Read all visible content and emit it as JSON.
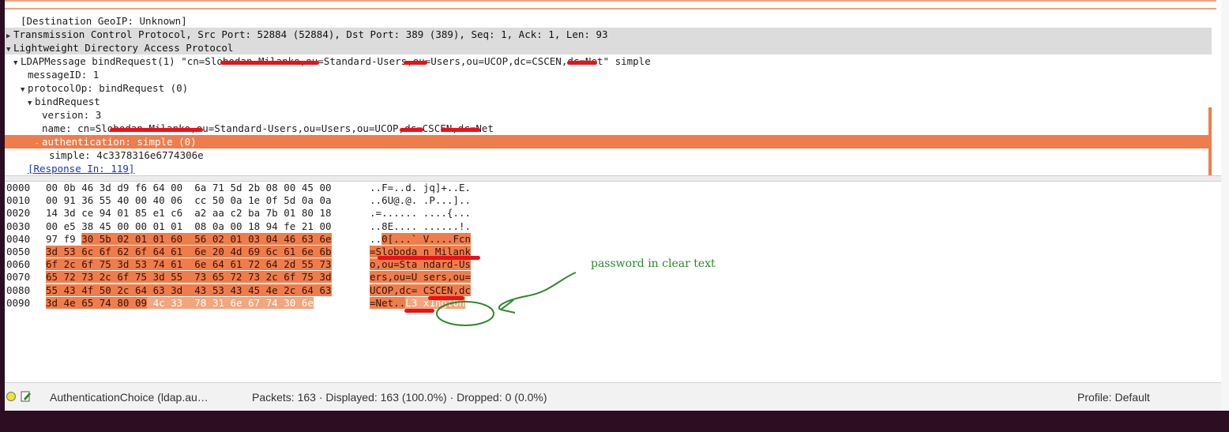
{
  "colors": {
    "selection": "#ef7d4c",
    "header_bg": "#dcdcdc",
    "link": "#1a35c8",
    "annotation": "#2a8a2a",
    "redaction": "#ef0f15"
  },
  "detail_tree": [
    {
      "indent": 1,
      "arrow": "",
      "text": "[Destination GeoIP: Unknown]",
      "kind": "normal"
    },
    {
      "indent": 0,
      "arrow": "▶",
      "text": "Transmission Control Protocol, Src Port: 52884 (52884), Dst Port: 389 (389), Seq: 1, Ack: 1, Len: 93",
      "kind": "header"
    },
    {
      "indent": 0,
      "arrow": "▼",
      "text": "Lightweight Directory Access Protocol",
      "kind": "header"
    },
    {
      "indent": 1,
      "arrow": "▼",
      "text": "LDAPMessage bindRequest(1) \"cn=Slobodan Milanko,ou=Standard-Users,ou=Users,ou=UCOP,dc=CSCEN,dc=Net\" simple",
      "kind": "normal"
    },
    {
      "indent": 2,
      "arrow": "",
      "text": "messageID: 1",
      "kind": "normal"
    },
    {
      "indent": 2,
      "arrow": "▼",
      "text": "protocolOp: bindRequest (0)",
      "kind": "normal"
    },
    {
      "indent": 3,
      "arrow": "▼",
      "text": "bindRequest",
      "kind": "normal"
    },
    {
      "indent": 4,
      "arrow": "",
      "text": "version: 3",
      "kind": "normal"
    },
    {
      "indent": 4,
      "arrow": "",
      "text": "name: cn=Slobodan Milanko,ou=Standard-Users,ou=Users,ou=UCOP,dc=CSCEN,dc=Net",
      "kind": "normal"
    },
    {
      "indent": 4,
      "arrow": "-",
      "text": "authentication: simple (0)",
      "kind": "selected"
    },
    {
      "indent": 5,
      "arrow": "",
      "text": "simple: 4c3378316e6774306e",
      "kind": "normal"
    },
    {
      "indent": 2,
      "arrow": "",
      "text": "[Response In: 119]",
      "kind": "link"
    }
  ],
  "hex_rows": [
    {
      "offset": "0000",
      "b1": "00 0b 46 3d d9 f6 64 00",
      "b2": "6a 71 5d 2b 08 00 45 00",
      "a1": "..F=..d.",
      "a2": "jq]+..E."
    },
    {
      "offset": "0010",
      "b1": "00 91 36 55 40 00 40 06",
      "b2": "cc 50 0a 1e 0f 5d 0a 0a",
      "a1": "..6U@.@.",
      "a2": ".P...]..",
      "_": ""
    },
    {
      "offset": "0020",
      "b1": "14 3d ce 94 01 85 e1 c6",
      "b2": "a2 aa c2 ba 7b 01 80 18",
      "a1": ".=......",
      "a2": "....{..."
    },
    {
      "offset": "0030",
      "b1": "00 e5 38 45 00 00 01 01",
      "b2": "08 0a 00 18 94 fe 21 00",
      "a1": "..8E....",
      "a2": "......!."
    },
    {
      "offset": "0040",
      "b1": "97 f9 30 5b 02 01 01 60",
      "b2": "56 02 01 03 04 46 63 6e",
      "a1": "..0[...`",
      "a2": "V....Fcn"
    },
    {
      "offset": "0050",
      "b1": "3d 53 6c 6f 62 6f 64 61",
      "b2": "6e 20 4d 69 6c 61 6e 6b",
      "a1": "=Slobodа",
      "a2": "n Milank"
    },
    {
      "offset": "0060",
      "b1": "6f 2c 6f 75 3d 53 74 61",
      "b2": "6e 64 61 72 64 2d 55 73",
      "a1": "o,ou=Sta",
      "a2": "ndard-Us"
    },
    {
      "offset": "0070",
      "b1": "65 72 73 2c 6f 75 3d 55",
      "b2": "73 65 72 73 2c 6f 75 3d",
      "a1": "ers,ou=U",
      "a2": "sers,ou="
    },
    {
      "offset": "0080",
      "b1": "55 43 4f 50 2c 64 63 3d",
      "b2": "43 53 43 45 4e 2c 64 63",
      "a1": "UCOP,dc=",
      "a2": "CSCEN,dc"
    },
    {
      "offset": "0090",
      "b1": "3d 4e 65 74 80 09 4c 33",
      "b2": "78 31 6e 67 74 30 6e",
      "a1": "=Net..L3",
      "a2": "x1ngt0n"
    }
  ],
  "annotation": "password in clear text",
  "statusbar": {
    "field": "AuthenticationChoice (ldap.au…",
    "packets": "Packets: 163 · Displayed: 163 (100.0%) · Dropped: 0 (0.0%)",
    "profile": "Profile: Default"
  }
}
